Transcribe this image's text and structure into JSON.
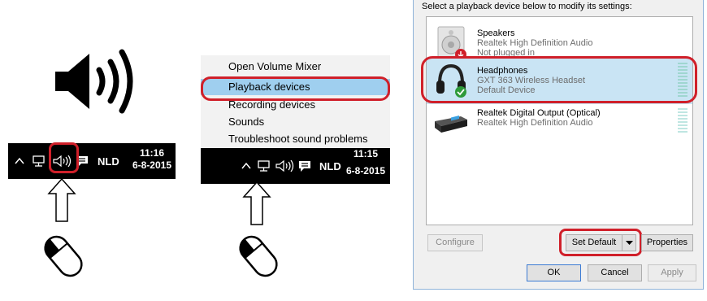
{
  "left_panel": {
    "taskbar": {
      "language": "NLD",
      "time": "11:16",
      "date": "6-8-2015"
    }
  },
  "middle_panel": {
    "menu_items": [
      "Open Volume Mixer",
      "Playback devices",
      "Recording devices",
      "Sounds",
      "Troubleshoot sound problems"
    ],
    "selected_item": "Playback devices",
    "taskbar": {
      "language": "NLD",
      "time": "11:15",
      "date": "6-8-2015"
    }
  },
  "dialog": {
    "instruction": "Select a playback device below to modify its settings:",
    "devices": [
      {
        "name": "Speakers",
        "line1": "Realtek High Definition Audio",
        "line2": "Not plugged in",
        "status_icon": "red-down-arrow-icon"
      },
      {
        "name": "Headphones",
        "line1": "GXT 363 Wireless Headset",
        "line2": "Default Device",
        "status_icon": "green-check-icon"
      },
      {
        "name": "Realtek Digital Output (Optical)",
        "line1": "Realtek High Definition Audio",
        "line2": ""
      }
    ],
    "selected_device": "Headphones",
    "buttons": {
      "configure": "Configure",
      "set_default": "Set Default",
      "properties": "Properties",
      "ok": "OK",
      "cancel": "Cancel",
      "apply": "Apply"
    }
  },
  "colors": {
    "highlight_ring": "#d0202a",
    "menu_selected": "#9fcfef",
    "row_selected": "#c9e4f4",
    "level_meter": "#bfe6e2"
  }
}
